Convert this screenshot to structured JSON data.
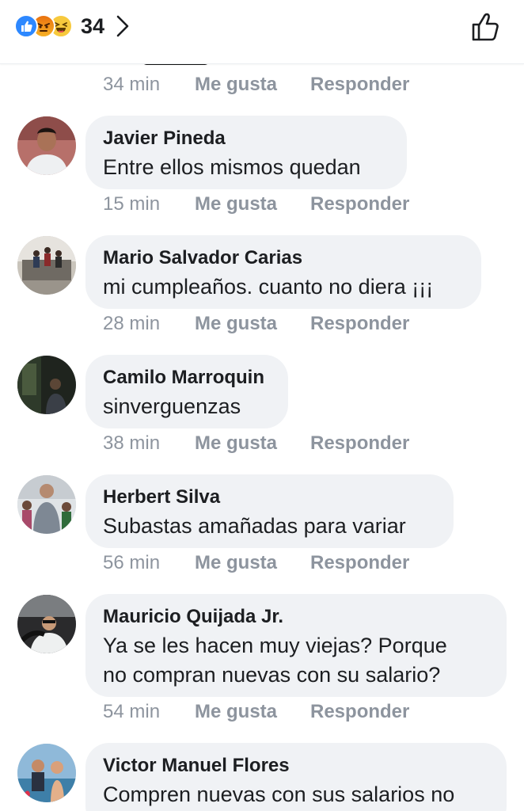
{
  "header": {
    "reaction_count": "34",
    "reaction_icons": [
      "like-icon",
      "angry-icon",
      "haha-icon"
    ],
    "accent": "#2d88ff"
  },
  "previous_comment": {
    "time": "34 min",
    "like_label": "Me gusta",
    "reply_label": "Responder"
  },
  "comments": [
    {
      "author": "Javier Pineda",
      "text": "Entre ellos mismos quedan",
      "time": "15 min",
      "like_label": "Me gusta",
      "reply_label": "Responder"
    },
    {
      "author": "Mario Salvador Carias",
      "text": "mi cumpleaños. cuanto no diera ¡¡¡",
      "time": "28 min",
      "like_label": "Me gusta",
      "reply_label": "Responder"
    },
    {
      "author": "Camilo Marroquin",
      "text": "sinverguenzas",
      "time": "38 min",
      "like_label": "Me gusta",
      "reply_label": "Responder"
    },
    {
      "author": "Herbert Silva",
      "text": "Subastas amañadas para variar",
      "time": "56 min",
      "like_label": "Me gusta",
      "reply_label": "Responder"
    },
    {
      "author": "Mauricio Quijada Jr.",
      "text_lines": [
        "Ya se les hacen muy viejas? Porque",
        "no compran nuevas con su salario?"
      ],
      "time": "54 min",
      "like_label": "Me gusta",
      "reply_label": "Responder"
    },
    {
      "author": "Victor Manuel Flores",
      "text": "Compren nuevas con sus salarios no"
    }
  ]
}
